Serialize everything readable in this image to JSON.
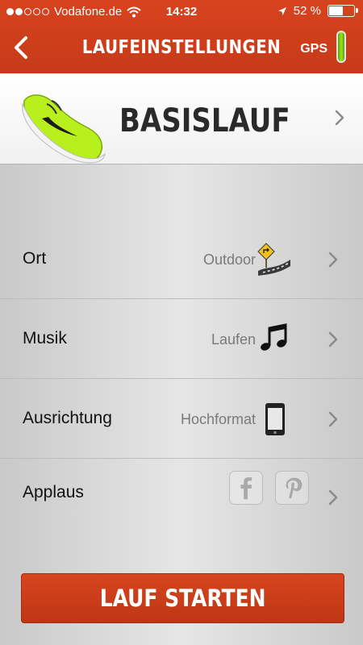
{
  "status_bar": {
    "carrier": "Vodafone.de",
    "time": "14:32",
    "battery_percent": "52 %",
    "battery_level": 0.52,
    "signal_strength": 2
  },
  "nav": {
    "title": "LAUFEINSTELLUNGEN",
    "gps_label": "GPS"
  },
  "header": {
    "title": "BASISLAUF"
  },
  "settings": {
    "ort": {
      "label": "Ort",
      "value": "Outdoor"
    },
    "musik": {
      "label": "Musik",
      "value": "Laufen"
    },
    "ausrichtung": {
      "label": "Ausrichtung",
      "value": "Hochformat"
    },
    "applaus": {
      "label": "Applaus"
    }
  },
  "start_button": {
    "label": "LAUF STARTEN"
  },
  "colors": {
    "accent": "#c63a18",
    "gps_indicator": "#8fdb1e",
    "shoe": "#b8f01e"
  }
}
